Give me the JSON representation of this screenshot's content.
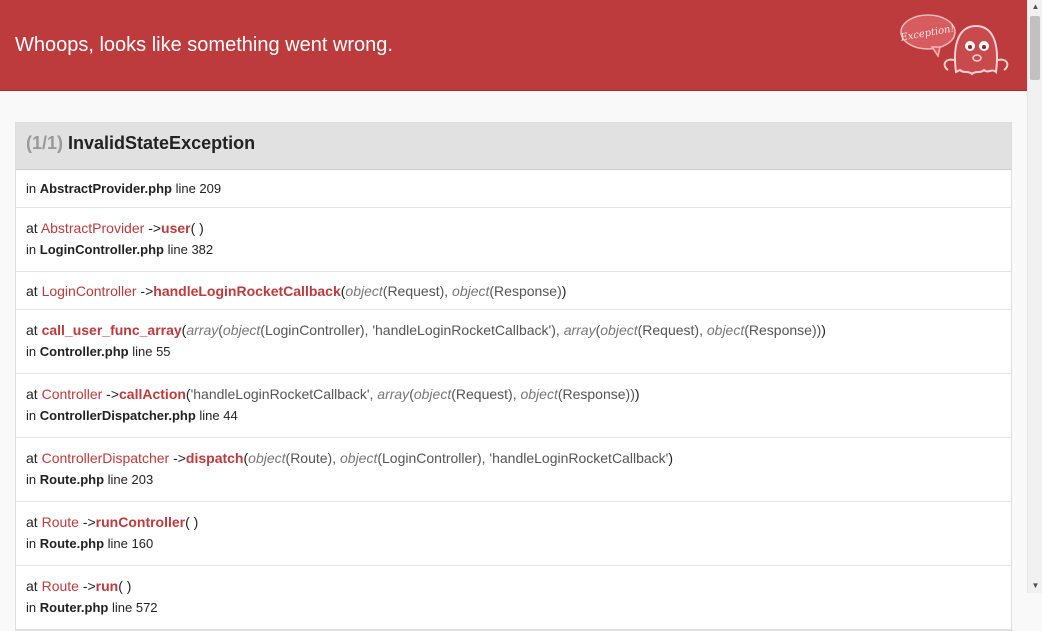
{
  "header": {
    "title": "Whoops, looks like something went wrong.",
    "logo": {
      "icon": "ghost-exception-icon",
      "bubble_text": "Exception!"
    },
    "color": "#bd3a3d"
  },
  "exception": {
    "count": "(1/1)",
    "name": "InvalidStateException"
  },
  "trace": [
    {
      "in_label": "in",
      "file": "AbstractProvider.php",
      "line_label": "line 209"
    },
    {
      "at_label": "at",
      "class": "AbstractProvider",
      "arrow": "->",
      "method": "user",
      "args_text": "( )",
      "in_label": "in",
      "file": "LoginController.php",
      "line_label": "line 382"
    },
    {
      "at_label": "at",
      "class": "LoginController",
      "arrow": "->",
      "method": "handleLoginRocketCallback",
      "args": [
        {
          "t": "p",
          "v": "("
        },
        {
          "t": "k",
          "v": "object"
        },
        {
          "t": "a",
          "v": "(Request), "
        },
        {
          "t": "k",
          "v": "object"
        },
        {
          "t": "a",
          "v": "(Response)"
        },
        {
          "t": "p",
          "v": ")"
        }
      ]
    },
    {
      "at_label": "at",
      "method": "call_user_func_array",
      "args": [
        {
          "t": "p",
          "v": "("
        },
        {
          "t": "k",
          "v": "array"
        },
        {
          "t": "a",
          "v": "("
        },
        {
          "t": "k",
          "v": "object"
        },
        {
          "t": "a",
          "v": "(LoginController), 'handleLoginRocketCallback'), "
        },
        {
          "t": "k",
          "v": "array"
        },
        {
          "t": "a",
          "v": "("
        },
        {
          "t": "k",
          "v": "object"
        },
        {
          "t": "a",
          "v": "(Request), "
        },
        {
          "t": "k",
          "v": "object"
        },
        {
          "t": "a",
          "v": "(Response))"
        },
        {
          "t": "p",
          "v": ")"
        }
      ],
      "in_label": "in",
      "file": "Controller.php",
      "line_label": "line 55"
    },
    {
      "at_label": "at",
      "class": "Controller",
      "arrow": "->",
      "method": "callAction",
      "args": [
        {
          "t": "p",
          "v": "("
        },
        {
          "t": "a",
          "v": "'handleLoginRocketCallback', "
        },
        {
          "t": "k",
          "v": "array"
        },
        {
          "t": "a",
          "v": "("
        },
        {
          "t": "k",
          "v": "object"
        },
        {
          "t": "a",
          "v": "(Request), "
        },
        {
          "t": "k",
          "v": "object"
        },
        {
          "t": "a",
          "v": "(Response))"
        },
        {
          "t": "p",
          "v": ")"
        }
      ],
      "in_label": "in",
      "file": "ControllerDispatcher.php",
      "line_label": "line 44"
    },
    {
      "at_label": "at",
      "class": "ControllerDispatcher",
      "arrow": "->",
      "method": "dispatch",
      "args": [
        {
          "t": "p",
          "v": "("
        },
        {
          "t": "k",
          "v": "object"
        },
        {
          "t": "a",
          "v": "(Route), "
        },
        {
          "t": "k",
          "v": "object"
        },
        {
          "t": "a",
          "v": "(LoginController), 'handleLoginRocketCallback'"
        },
        {
          "t": "p",
          "v": ")"
        }
      ],
      "in_label": "in",
      "file": "Route.php",
      "line_label": "line 203"
    },
    {
      "at_label": "at",
      "class": "Route",
      "arrow": "->",
      "method": "runController",
      "args_text": "( )",
      "in_label": "in",
      "file": "Route.php",
      "line_label": "line 160"
    },
    {
      "at_label": "at",
      "class": "Route",
      "arrow": "->",
      "method": "run",
      "args_text": "( )",
      "in_label": "in",
      "file": "Router.php",
      "line_label": "line 572"
    }
  ]
}
